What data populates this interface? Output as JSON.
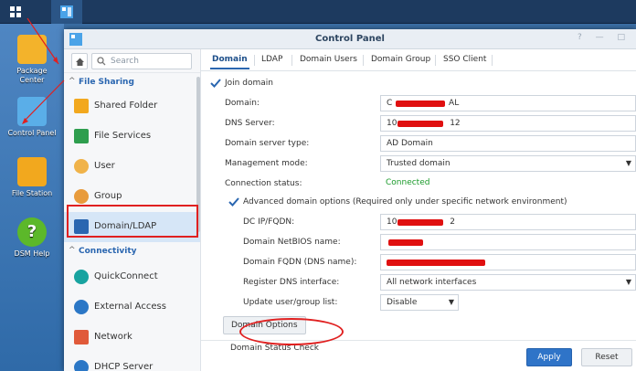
{
  "window": {
    "title": "Control Panel",
    "controls": "? — □"
  },
  "desktop": {
    "icons": [
      {
        "name": "package-center",
        "label": "Package\nCenter"
      },
      {
        "name": "control-panel",
        "label": "Control Panel"
      },
      {
        "name": "file-station",
        "label": "File Station"
      },
      {
        "name": "dsm-help",
        "label": "DSM Help"
      }
    ]
  },
  "sidebar": {
    "search_placeholder": "Search",
    "sections": [
      {
        "label": "File Sharing"
      },
      {
        "label": "Connectivity"
      }
    ],
    "items": [
      {
        "label": "Shared Folder"
      },
      {
        "label": "File Services"
      },
      {
        "label": "User"
      },
      {
        "label": "Group"
      },
      {
        "label": "Domain/LDAP"
      },
      {
        "label": "QuickConnect"
      },
      {
        "label": "External Access"
      },
      {
        "label": "Network"
      },
      {
        "label": "DHCP Server"
      }
    ]
  },
  "tabs": [
    "Domain",
    "LDAP",
    "Domain Users",
    "Domain Group",
    "SSO Client"
  ],
  "form": {
    "join_domain": "Join domain",
    "domain_label": "Domain:",
    "domain_value_prefix": "C",
    "domain_value_suffix": "AL",
    "dns_label": "DNS Server:",
    "dns_value_prefix": "10",
    "dns_value_suffix": "12",
    "server_type_label": "Domain server type:",
    "server_type_value": "AD Domain",
    "mgmt_label": "Management mode:",
    "mgmt_value": "Trusted domain",
    "status_label": "Connection status:",
    "status_value": "Connected",
    "advanced_label": "Advanced domain options (Required only under specific network environment)",
    "dc_label": "DC IP/FQDN:",
    "dc_value_prefix": "10",
    "dc_value_suffix": "2",
    "netbios_label": "Domain NetBIOS name:",
    "fqdn_label": "Domain FQDN (DNS name):",
    "register_label": "Register DNS interface:",
    "register_value": "All network interfaces",
    "update_label": "Update user/group list:",
    "update_value": "Disable",
    "domain_options_button": "Domain Options",
    "status_check_button": "Domain Status Check"
  },
  "footer": {
    "apply": "Apply",
    "reset": "Reset"
  },
  "colors": {
    "accent": "#2a66b0",
    "connected": "#1a9a2a",
    "annotation": "#e02020"
  }
}
